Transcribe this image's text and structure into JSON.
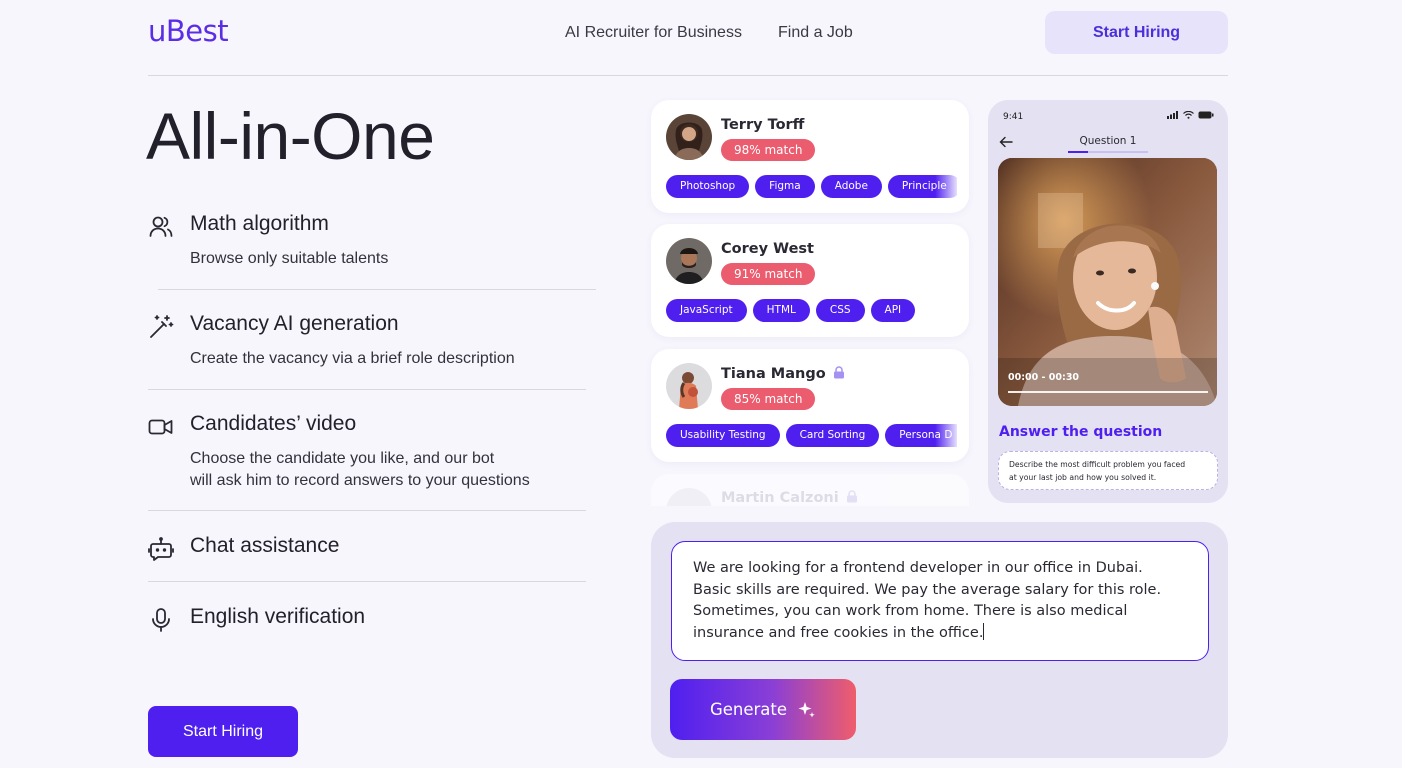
{
  "header": {
    "logo": "uBest",
    "nav": [
      "AI Recruiter for Business",
      "Find a Job"
    ],
    "cta_label": "Start Hiring"
  },
  "hero": {
    "title": "All-in-One",
    "features": [
      {
        "icon": "users-icon",
        "title": "Math algorithm",
        "desc_lines": [
          "Browse only suitable talents"
        ]
      },
      {
        "icon": "magic-wand-icon",
        "title": "Vacancy AI generation",
        "desc_lines": [
          "Create the vacancy via a brief role description"
        ]
      },
      {
        "icon": "video-camera-icon",
        "title": "Candidates’ video",
        "desc_lines": [
          "Choose the candidate you like, and our bot",
          "will ask him to record answers to your questions"
        ]
      },
      {
        "icon": "chat-bot-icon",
        "title": "Chat assistance",
        "desc_lines": []
      },
      {
        "icon": "microphone-icon",
        "title": "English verification",
        "desc_lines": []
      }
    ],
    "cta_label": "Start Hiring"
  },
  "candidates": [
    {
      "name": "Terry Torff",
      "match": "98% match",
      "locked": false,
      "tags": [
        "Photoshop",
        "Figma",
        "Adobe",
        "Principle"
      ]
    },
    {
      "name": "Corey West",
      "match": "91% match",
      "locked": false,
      "tags": [
        "JavaScript",
        "HTML",
        "CSS",
        "API"
      ]
    },
    {
      "name": "Tiana Mango",
      "match": "85% match",
      "locked": true,
      "tags": [
        "Usability Testing",
        "Card Sorting",
        "Persona D"
      ]
    },
    {
      "name": "Martin Calzoni",
      "locked": true
    }
  ],
  "phone": {
    "time": "9:41",
    "question_label": "Question 1",
    "timecode": "00:00 - 00:30",
    "answer_heading": "Answer the question",
    "prompt_lines": [
      "Describe the most difficult problem you faced",
      "at your last job and how you solved it."
    ],
    "progress": 0.25
  },
  "generator": {
    "text_lines": [
      "We are looking for a frontend developer in our office in Dubai.",
      "Basic skills are required. We pay the average salary for this role.",
      "Sometimes, you can work from home. There is also medical",
      "insurance and free cookies in the office."
    ],
    "button_label": "Generate"
  },
  "colors": {
    "brand": "#4f1ff0",
    "match": "#eb5c6e",
    "panel": "#e3e1f2",
    "background": "#f7f6fd"
  }
}
